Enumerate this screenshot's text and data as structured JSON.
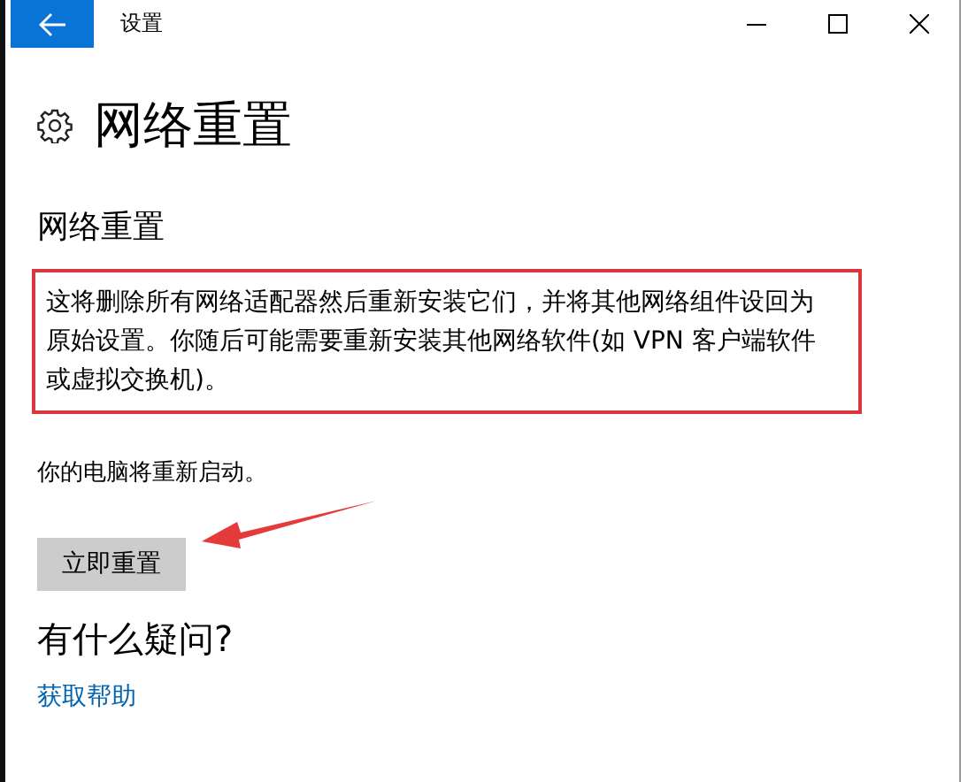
{
  "window": {
    "title": "设置"
  },
  "page_title": "网络重置",
  "section": {
    "title": "网络重置",
    "description": "这将删除所有网络适配器然后重新安装它们，并将其他网络组件设回为原始设置。你随后可能需要重新安装其他网络软件(如 VPN 客户端软件或虚拟交换机)。",
    "note": "你的电脑将重新启动。",
    "button": "立即重置"
  },
  "help": {
    "title": "有什么疑问?",
    "link": "获取帮助"
  }
}
